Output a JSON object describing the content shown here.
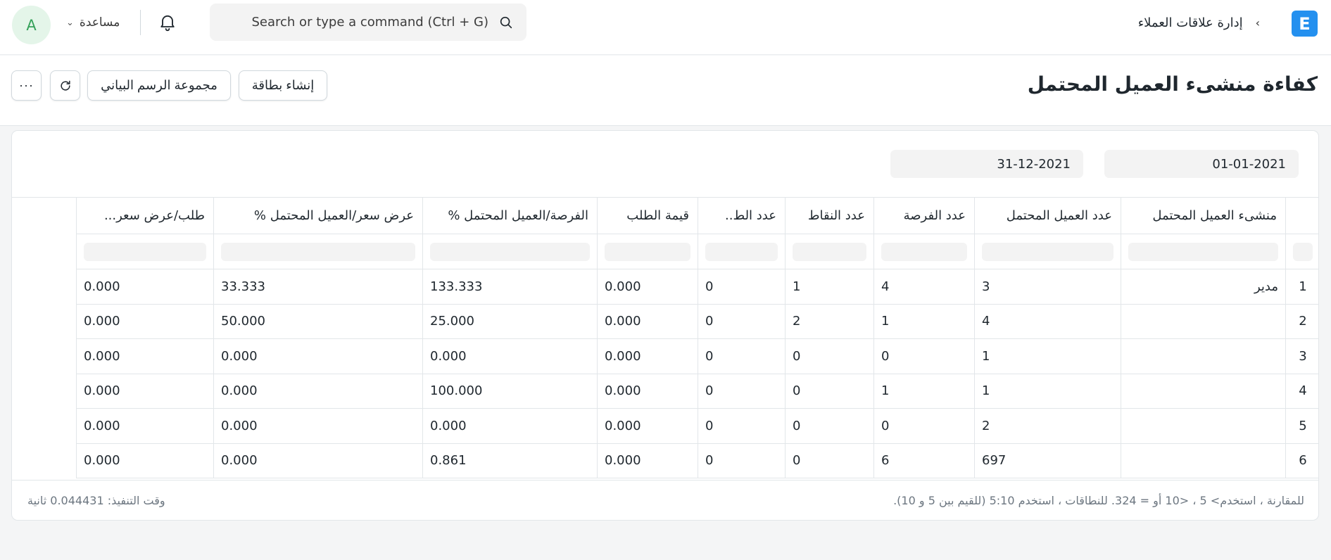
{
  "navbar": {
    "avatar_initial": "A",
    "help_label": "مساعدة",
    "search_placeholder": "Search or type a command (Ctrl + G)",
    "breadcrumb": "إدارة علاقات العملاء",
    "app_logo_letter": "E",
    "accent_color": "#2490ef"
  },
  "page": {
    "title": "كفاءة منشىء العميل المحتمل",
    "buttons": {
      "create_card": "إنشاء بطاقة",
      "chart_group": "مجموعة الرسم البياني",
      "more": "···"
    }
  },
  "filters": {
    "from_date": "01-01-2021",
    "to_date": "31-12-2021"
  },
  "table": {
    "columns": [
      "منشىء العميل المحتمل",
      "عدد العميل المحتمل",
      "عدد الفرصة",
      "عدد النقاط",
      "عدد الط..",
      "قيمة الطلب",
      "الفرصة/العميل المحتمل %",
      "عرض سعر/العميل المحتمل %",
      "طلب/عرض سعر..."
    ],
    "rows": [
      {
        "idx": "1",
        "owner": "مدير",
        "lead_count": "3",
        "opp_count": "4",
        "quot_count": "1",
        "order_count": "0",
        "order_value": "0.000",
        "opp_lead": "133.333",
        "quot_lead": "33.333",
        "order_quot": "0.000"
      },
      {
        "idx": "2",
        "owner": "",
        "lead_count": "4",
        "opp_count": "1",
        "quot_count": "2",
        "order_count": "0",
        "order_value": "0.000",
        "opp_lead": "25.000",
        "quot_lead": "50.000",
        "order_quot": "0.000"
      },
      {
        "idx": "3",
        "owner": "",
        "lead_count": "1",
        "opp_count": "0",
        "quot_count": "0",
        "order_count": "0",
        "order_value": "0.000",
        "opp_lead": "0.000",
        "quot_lead": "0.000",
        "order_quot": "0.000"
      },
      {
        "idx": "4",
        "owner": "",
        "lead_count": "1",
        "opp_count": "1",
        "quot_count": "0",
        "order_count": "0",
        "order_value": "0.000",
        "opp_lead": "100.000",
        "quot_lead": "0.000",
        "order_quot": "0.000"
      },
      {
        "idx": "5",
        "owner": "",
        "lead_count": "2",
        "opp_count": "0",
        "quot_count": "0",
        "order_count": "0",
        "order_value": "0.000",
        "opp_lead": "0.000",
        "quot_lead": "0.000",
        "order_quot": "0.000"
      },
      {
        "idx": "6",
        "owner": "",
        "lead_count": "697",
        "opp_count": "6",
        "quot_count": "0",
        "order_count": "0",
        "order_value": "0.000",
        "opp_lead": "0.861",
        "quot_lead": "0.000",
        "order_quot": "0.000"
      }
    ]
  },
  "footer": {
    "hint": "للمقارنة ، استخدم> 5 ، <10 أو = 324. للنطاقات ، استخدم 5:10 (للقيم بين 5 و 10).",
    "execution_time": "وقت التنفيذ: 0.044431 ثانية"
  }
}
